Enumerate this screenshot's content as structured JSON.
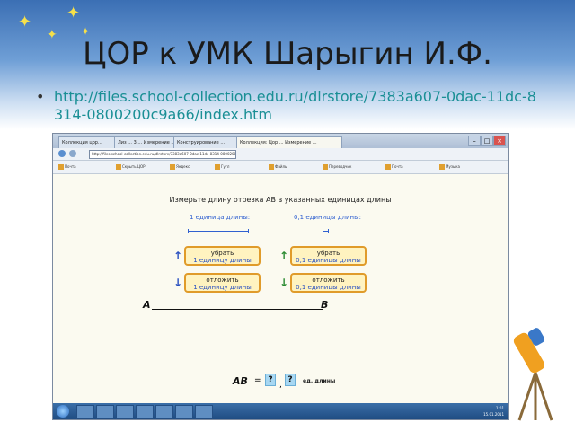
{
  "slide": {
    "title": "ЦОР к УМК Шарыгин И.Ф.",
    "bullet_link": "http://files.school-collection.edu.ru/dlrstore/7383a607-0dac-11dc-8314-0800200c9a66/index.htm"
  },
  "browser": {
    "tabs": [
      "Коллекция цор...",
      "Лиз ... 3 ... Измерение ...",
      "Конструирование ...",
      "Коллекция: Цор ... Измерение ..."
    ],
    "address": "http://files.school-collection.edu.ru/dlrstore/7383a607-0dac-11dc-8314-0800200c9a66/index.htm",
    "toolbar_items": [
      "Почта",
      "Скрыть ЦОР",
      "Яндекс",
      "Гугл",
      "Файлы",
      "Переводчик",
      "Почта",
      "Музыка"
    ]
  },
  "exercise": {
    "task": "Измерьте длину отрезка AB в указанных единицах длины",
    "unit1_label": "1 единица длины:",
    "unit01_label": "0,1 единицы длины:",
    "buttons": [
      {
        "line1": "убрать",
        "line2": "1 единицу длины"
      },
      {
        "line1": "убрать",
        "line2": "0,1 единицы длины"
      },
      {
        "line1": "отложить",
        "line2": "1 единицу длины"
      },
      {
        "line1": "отложить",
        "line2": "0,1 единицы длины"
      }
    ],
    "point_a": "A",
    "point_b": "B",
    "ab_label": "AB",
    "equals": "=",
    "q1": "?",
    "q2": "?",
    "comma": ",",
    "units": "ед. длины"
  },
  "taskbar": {
    "tray_time": "1:01",
    "tray_date": "15.01.2011"
  }
}
